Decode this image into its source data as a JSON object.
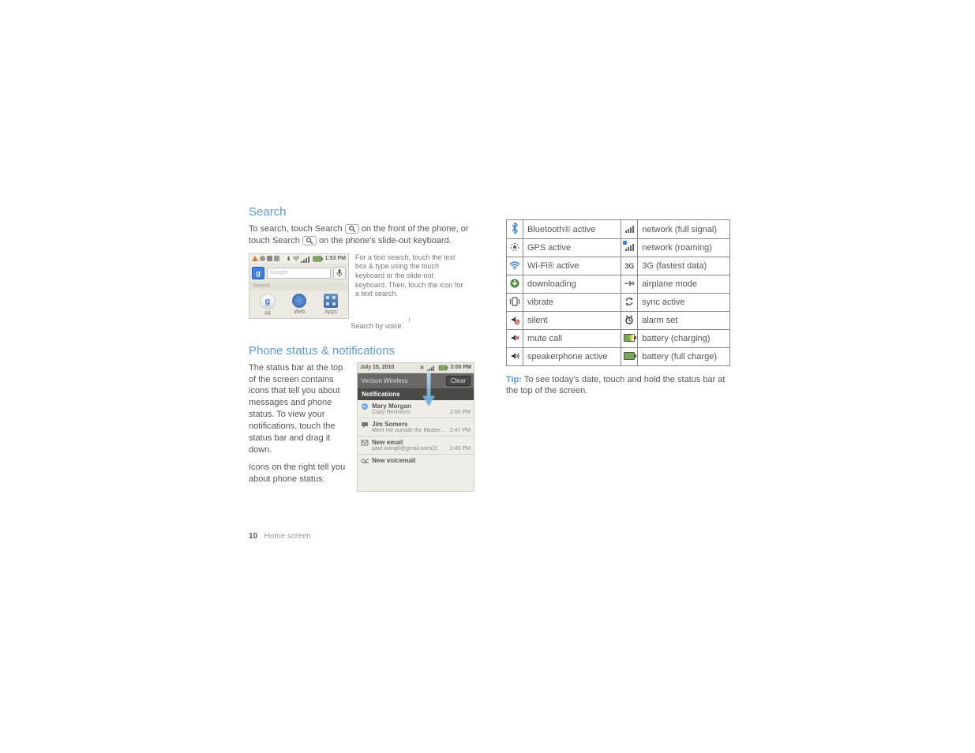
{
  "sections": {
    "search_title": "Search",
    "search_body_1": "To search, touch Search ",
    "search_body_2": " on the front of the phone, or touch Search ",
    "search_body_3": " on the phone's slide-out keyboard.",
    "search_callout": "For a text search, touch the text box & type using the touch keyboard or the slide-out keyboard. Then, touch the icon for a text search.",
    "voice_callout": "Search by voice.",
    "status_title": "Phone status & notifications",
    "status_body_1": "The status bar at the top of the screen contains icons that tell you about messages and phone status. To view your notifications, touch the status bar and drag it down.",
    "status_body_2": "Icons on the right tell you about phone status:"
  },
  "search_widget": {
    "time": "1:53 PM",
    "placeholder": "Google",
    "tab_label": "Search",
    "icons": {
      "all": "All",
      "web": "Web",
      "apps": "Apps"
    }
  },
  "notifications": {
    "date": "July 15, 2010",
    "time": "3:00 PM",
    "carrier": "Verizon Wireless",
    "clear": "Clear",
    "header": "Notifications",
    "rows": [
      {
        "title": "Mary Morgan",
        "sub": "Copy Revisions",
        "time": "2:50 PM",
        "icon": "chat"
      },
      {
        "title": "Jim Somers",
        "sub": "Meet me outside the theater...",
        "time": "2:47 PM",
        "icon": "sms"
      },
      {
        "title": "New email",
        "sub": "paul.wang6@gmail.com(2)",
        "time": "2:45 PM",
        "icon": "mail"
      },
      {
        "title": "New voicemail",
        "sub": "",
        "time": "",
        "icon": "vm"
      }
    ]
  },
  "status_icons": {
    "left": [
      {
        "label": "Bluetooth® active",
        "icon": "bluetooth"
      },
      {
        "label": "GPS active",
        "icon": "gps"
      },
      {
        "label": "Wi-Fi® active",
        "icon": "wifi"
      },
      {
        "label": "downloading",
        "icon": "download"
      },
      {
        "label": "vibrate",
        "icon": "vibrate"
      },
      {
        "label": "silent",
        "icon": "silent"
      },
      {
        "label": "mute call",
        "icon": "mute"
      },
      {
        "label": "speakerphone active",
        "icon": "speaker"
      }
    ],
    "right": [
      {
        "label": "network (full signal)",
        "icon": "signal"
      },
      {
        "label": "network (roaming)",
        "icon": "roaming"
      },
      {
        "label": "3G (fastest data)",
        "icon": "3g"
      },
      {
        "label": "airplane mode",
        "icon": "airplane"
      },
      {
        "label": "sync active",
        "icon": "sync"
      },
      {
        "label": "alarm set",
        "icon": "alarm"
      },
      {
        "label": "battery (charging)",
        "icon": "batt-chg"
      },
      {
        "label": "battery (full charge)",
        "icon": "batt-full"
      }
    ]
  },
  "tip": {
    "label": "Tip:",
    "text": " To see today's date, touch and hold the status bar at the top of the screen."
  },
  "footer": {
    "page": "10",
    "section": "Home screen"
  }
}
